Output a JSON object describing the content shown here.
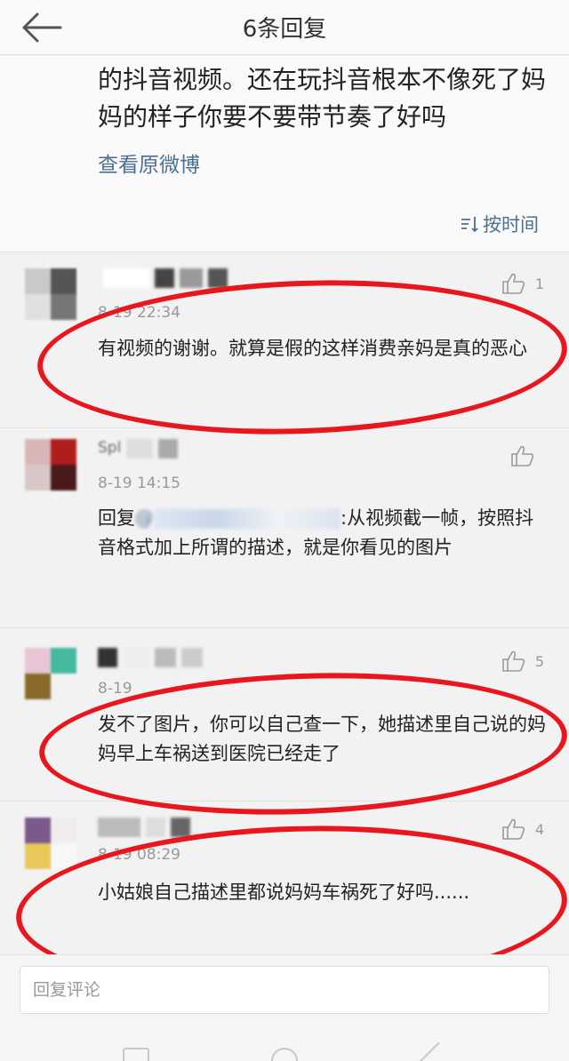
{
  "header": {
    "title": "6条回复"
  },
  "post": {
    "text": "的抖音视频。还在玩抖音根本不像死了妈妈的样子你要不要带节奏了好吗",
    "view_original": "查看原微博",
    "sort_label": "按时间"
  },
  "comments": [
    {
      "time": "8-19 22:34",
      "text": "有视频的谢谢。就算是假的这样消费亲妈是真的恶心",
      "likes": "1"
    },
    {
      "username": "Spl",
      "time": "8-19 14:15",
      "reply_prefix": "回复",
      "mention": "@",
      "text": ":从视频截一帧，按照抖音格式加上所谓的描述，就是你看见的图片",
      "likes": ""
    },
    {
      "time": "8-19",
      "text": "发不了图片，你可以自己查一下，她描述里自己说的妈妈早上车祸送到医院已经走了",
      "likes": "5"
    },
    {
      "time": "8-19 08:29",
      "text": "小姑娘自己描述里都说妈妈车祸死了好吗......",
      "likes": "4"
    }
  ],
  "reply_bar": {
    "placeholder": "回复评论"
  },
  "colors": {
    "link": "#4b6f95",
    "circle_annotation": "#e8171e"
  }
}
